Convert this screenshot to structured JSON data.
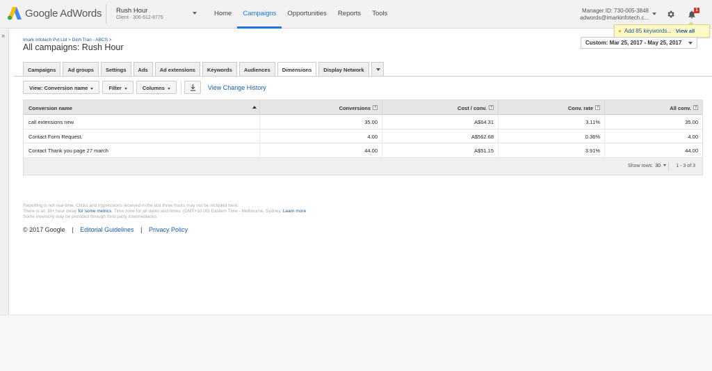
{
  "header": {
    "brand": "Google AdWords",
    "account_name": "Rush Hour",
    "account_sub": "Client · 306-612-8775",
    "nav": [
      "Home",
      "Campaigns",
      "Opportunities",
      "Reports",
      "Tools"
    ],
    "active_nav": "Campaigns",
    "manager_id": "Manager ID: 730-005-3848",
    "manager_email": "adwords@imarkinfotech.c...",
    "notification_count": "1",
    "notification_text": "Add 85 keywords...",
    "notification_link": "View all"
  },
  "breadcrumb": "Imark Infotech Pvt Ltd > Dinh Tran - ABCS >",
  "page_title": "All campaigns: Rush Hour",
  "date_range": "Custom: Mar 25, 2017 - May 25, 2017",
  "tabs": [
    "Campaigns",
    "Ad groups",
    "Settings",
    "Ads",
    "Ad extensions",
    "Keywords",
    "Audiences",
    "Dimensions",
    "Display Network"
  ],
  "active_tab": "Dimensions",
  "toolbar": {
    "view": "View: Conversion name",
    "filter": "Filter",
    "columns": "Columns",
    "history": "View Change History"
  },
  "table": {
    "columns": [
      "Conversion name",
      "Conversions",
      "Cost / conv.",
      "Conv. rate",
      "All conv."
    ],
    "rows": [
      [
        "call extensions new",
        "35.00",
        "A$64.31",
        "3.11%",
        "35.00"
      ],
      [
        "Contact Form Request.",
        "4.00",
        "A$562.68",
        "0.36%",
        "4.00"
      ],
      [
        "Contact Thank you page 27 march",
        "44.00",
        "A$51.15",
        "3.91%",
        "44.00"
      ]
    ],
    "show_rows_label": "Show rows:",
    "show_rows_value": "30",
    "range": "1 - 3 of 3"
  },
  "disclaimer": {
    "line1": "Reporting is not real-time. Clicks and impressions received in the last three hours may not be included here.",
    "line2_pre": "There is an 18+ hour delay",
    "line2_link": "for some metrics",
    "line2_post": ". Time zone for all dates and times: (GMT+10:00) Eastern Time - Melbourne, Sydney.",
    "learn_more": "Learn more",
    "line3": "Some inventory may be provided through third party intermediaries."
  },
  "footer": {
    "copyright": "© 2017 Google",
    "editorial": "Editorial Guidelines",
    "privacy": "Privacy Policy",
    "separator": "|"
  },
  "colors": {
    "accent": "#1a73e8",
    "link": "#1a5aa6",
    "notify_bg": "#fff9c4",
    "badge": "#d93025"
  }
}
